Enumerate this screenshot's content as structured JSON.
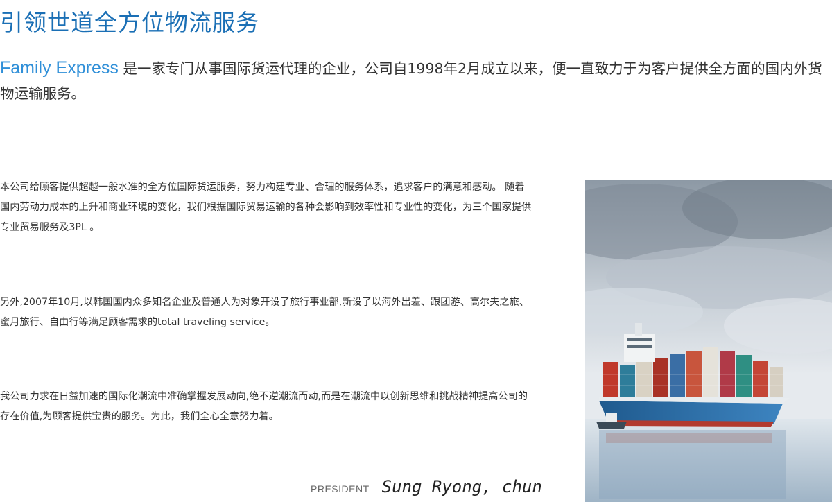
{
  "header": {
    "title": "引领世道全方位物流服务"
  },
  "intro": {
    "brand": "Family Express",
    "text": " 是一家专门从事国际货运代理的企业，公司自1998年2月成立以来，便一直致力于为客户提供全方面的国内外货物运输服务。"
  },
  "body": {
    "paragraph_1": "本公司给顾客提供超越一般水准的全方位国际货运服务，努力构建专业、合理的服务体系，追求客户的满意和感动。  随着国内劳动力成本的上升和商业环境的变化，我们根据国际贸易运输的各种会影响到效率性和专业性的变化，为三个国家提供专业贸易服务及3PL 。",
    "paragraph_2": "另外,2007年10月,以韩国国内众多知名企业及普通人为对象开设了旅行事业部,新设了以海外出差、跟团游、高尔夫之旅、蜜月旅行、自由行等满足顾客需求的total traveling service。",
    "paragraph_3": "我公司力求在日益加速的国际化潮流中准确掌握发展动向,绝不逆潮流而动,而是在潮流中以创新思维和挑战精神提高公司的存在价值,为顾客提供宝贵的服务。为此，我们全心全意努力着。"
  },
  "signature": {
    "label": "PRESIDENT",
    "name": "Sung Ryong, chun"
  },
  "image": {
    "subject": "container-ship-photo",
    "colors": {
      "sky_top": "#8d99a5",
      "sky_bottom": "#e6eaee",
      "sea": "#c9d6e2",
      "hull_blue": "#2e6fa8",
      "hull_red": "#b23a2e",
      "brand": "#1a6fb5"
    }
  }
}
